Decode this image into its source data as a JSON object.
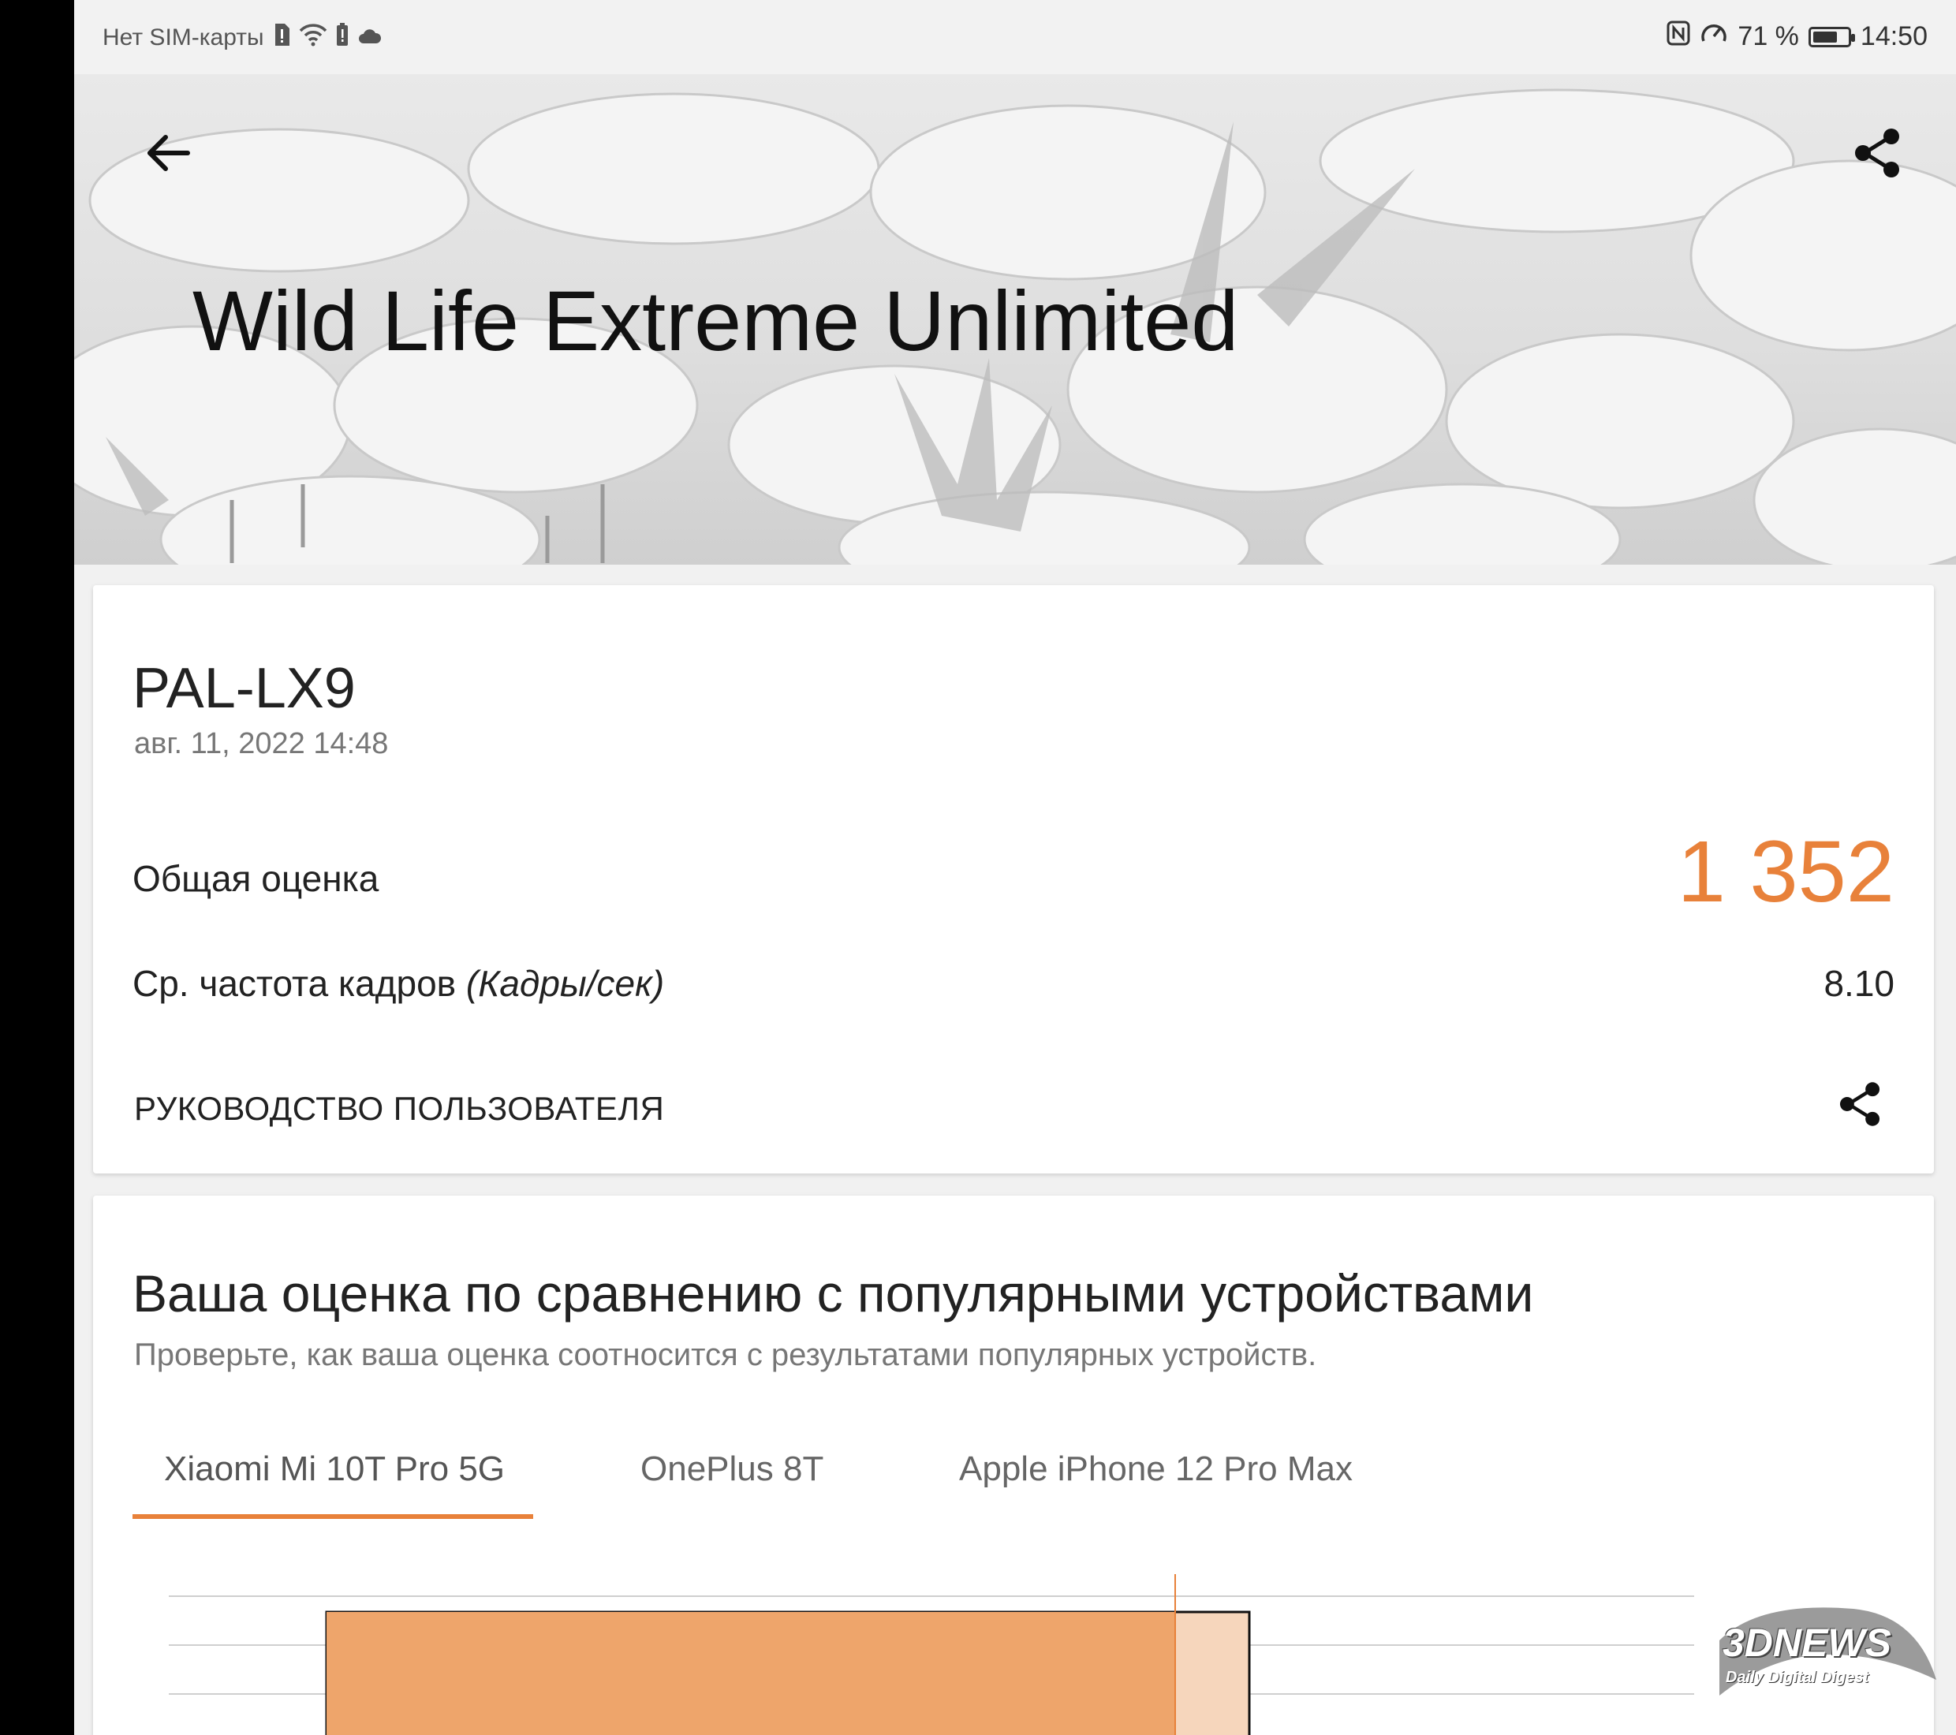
{
  "status_bar": {
    "carrier": "Нет SIM-карты",
    "battery_percent": "71 %",
    "battery_level": 0.71,
    "time": "14:50"
  },
  "header": {
    "title": "Wild Life Extreme Unlimited",
    "back_icon": "arrow-left-icon",
    "share_icon": "share-icon"
  },
  "result": {
    "device_name": "PAL-LX9",
    "date": "авг. 11, 2022 14:48",
    "overall_label": "Общая оценка",
    "overall_score": "1 352",
    "fps_label": "Ср. частота кадров",
    "fps_unit": "(Кадры/сек)",
    "fps_value": "8.10",
    "guide_label": "РУКОВОДСТВО ПОЛЬЗОВАТЕЛЯ"
  },
  "compare": {
    "title": "Ваша оценка по сравнению с популярными устройствами",
    "subtitle": "Проверьте, как ваша оценка соотносится с результатами популярных устройств.",
    "tabs": [
      "Xiaomi Mi 10T Pro 5G",
      "OnePlus 8T",
      "Apple iPhone 12 Pro Max"
    ],
    "active_tab": 0
  },
  "chart_data": {
    "type": "bar",
    "orientation": "horizontal",
    "note_visible": "partially cropped at bottom",
    "values": [
      1352
    ],
    "reference_fraction": 0.92,
    "bar_color": "#eea56b",
    "reference_band_color": "#f6d6bc",
    "marker_color": "#e8813a"
  },
  "colors": {
    "accent": "#e8813a",
    "background": "#f1f1f1",
    "card": "#ffffff"
  },
  "watermark": {
    "brand": "3DNEWS",
    "tagline": "Daily Digital Digest"
  }
}
